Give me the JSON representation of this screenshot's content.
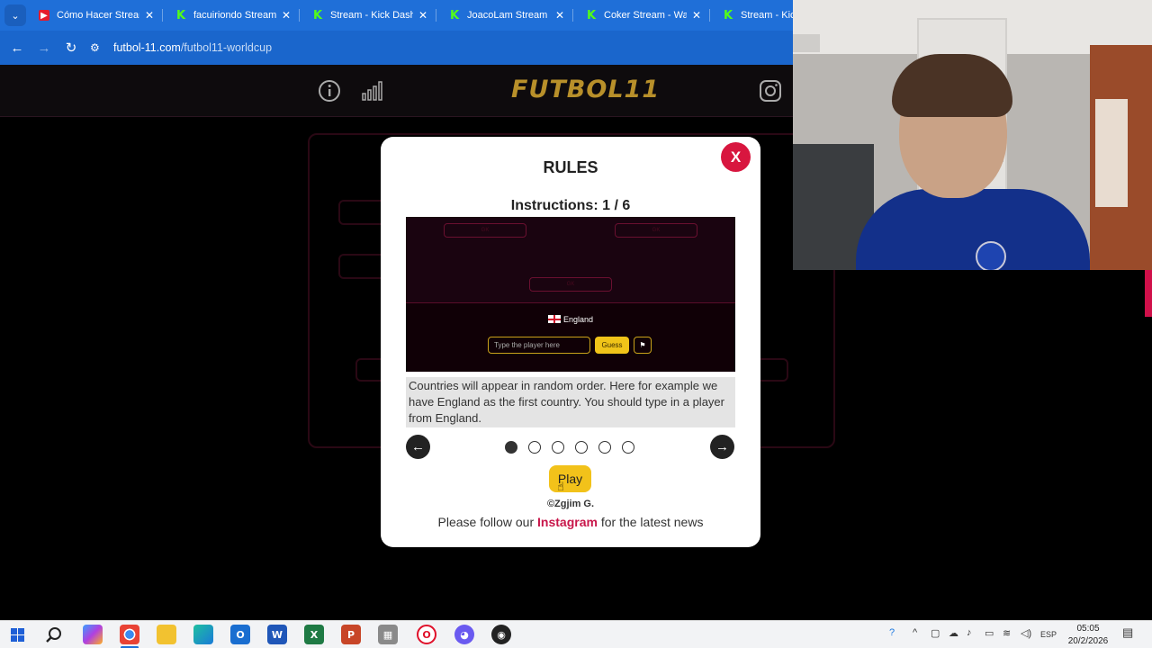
{
  "browser": {
    "tabs": [
      {
        "label": "Cómo Hacer Streams",
        "favicon": "youtube-icon"
      },
      {
        "label": "facuiriondo Stream -",
        "favicon": "kick-icon"
      },
      {
        "label": "Stream - Kick Dashbo",
        "favicon": "kick-icon"
      },
      {
        "label": "JoacoLam Stream - V",
        "favicon": "kick-icon"
      },
      {
        "label": "Coker Stream - Watc",
        "favicon": "kick-icon"
      },
      {
        "label": "Stream - Kick",
        "favicon": "kick-icon"
      }
    ],
    "url_host": "futbol-11.com",
    "url_path": "/futbol11-worldcup"
  },
  "site": {
    "logo_text": "FUTBOL",
    "logo_number": "11",
    "logo_color": "#b8902a"
  },
  "modal": {
    "close_label": "X",
    "title": "RULES",
    "step": "Instructions: 1 / 6",
    "preview": {
      "slot_label": "GK",
      "country": "England",
      "input_placeholder": "Type the player here",
      "guess_label": "Guess"
    },
    "description": "Countries will appear in random order. Here for example we have England as the first country. You should type in a player from England.",
    "prev_icon": "arrow-left-icon",
    "next_icon": "arrow-right-icon",
    "pagination": {
      "current": 1,
      "total": 6
    },
    "play_label": "Play",
    "credit": "©Zgjim G.",
    "follow_prefix": "Please follow our ",
    "follow_link": "Instagram",
    "follow_suffix": " for the latest news",
    "accent_color": "#d8163f",
    "play_color": "#f2c21a"
  },
  "taskbar": {
    "language": "ESP",
    "time": "05:05",
    "date": "20/2/2026"
  }
}
